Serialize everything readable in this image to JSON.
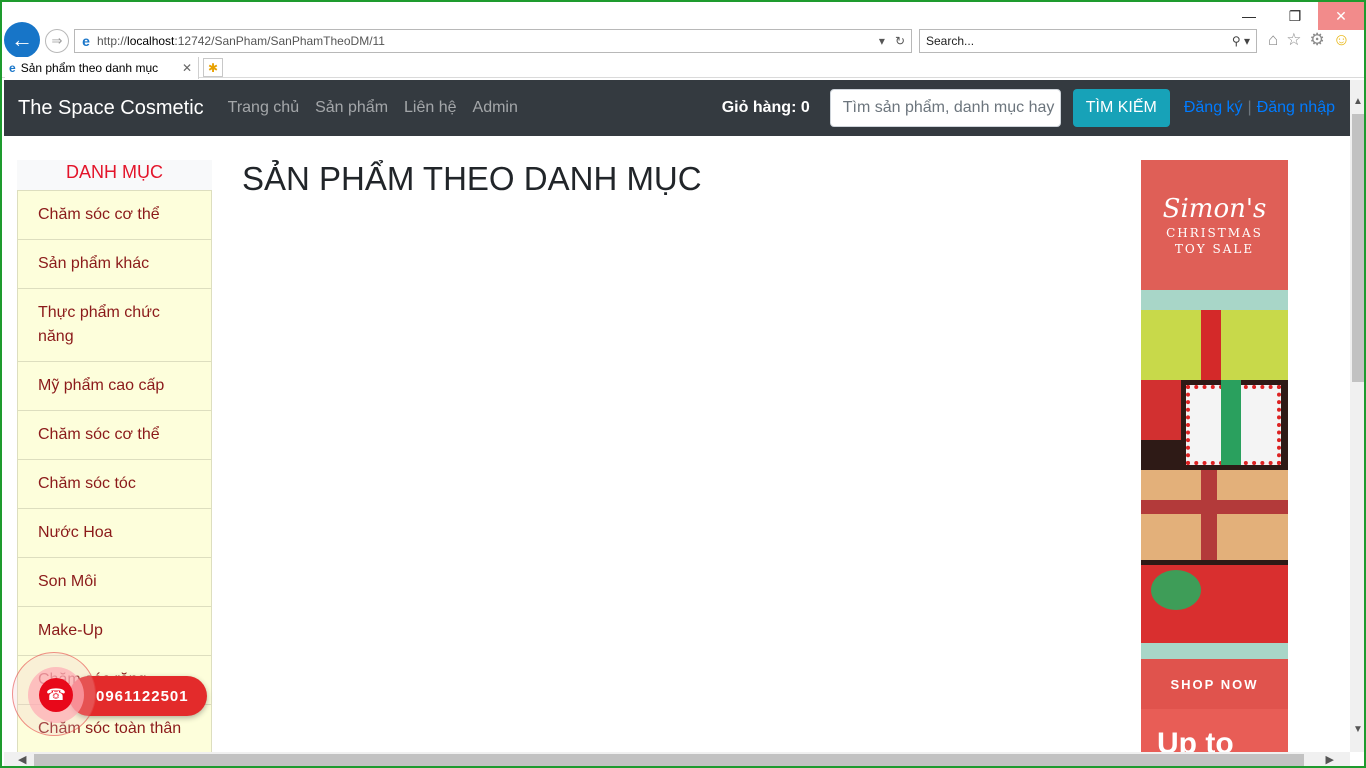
{
  "browser": {
    "url_prefix": "http://",
    "url_host": "localhost",
    "url_path": ":12742/SanPham/SanPhamTheoDM/11",
    "search_placeholder": "Search...",
    "tab_title": "Sản phẩm theo danh mục"
  },
  "navbar": {
    "brand": "The Space Cosmetic",
    "links": [
      "Trang chủ",
      "Sản phẩm",
      "Liên hệ",
      "Admin"
    ],
    "cart_label": "Giỏ hàng: 0",
    "search_placeholder": "Tìm sản phẩm, danh mục hay",
    "search_button": "TÌM KIẾM",
    "register": "Đăng ký",
    "separator": "|",
    "login": "Đăng nhập"
  },
  "sidebar": {
    "heading": "DANH MỤC",
    "categories": [
      "Chăm sóc cơ thể",
      "Sản phẩm khác",
      "Thực phẩm chức năng",
      "Mỹ phẩm cao cấp",
      "Chăm sóc cơ thể",
      "Chăm sóc tóc",
      "Nước Hoa",
      "Son Môi",
      "Make-Up",
      "Chăm sóc răng",
      "Chăm sóc toàn thân"
    ]
  },
  "main": {
    "title": "SẢN PHẨM THEO DANH MỤC"
  },
  "ad": {
    "brand": "Simon's",
    "line1": "CHRISTMAS",
    "line2": "TOY SALE",
    "shop": "SHOP NOW",
    "upto": "Up to"
  },
  "call": {
    "phone": "0961122501"
  },
  "colors": {
    "navbar_bg": "#343a40",
    "search_btn": "#17a2b8",
    "link_blue": "#007bff",
    "category_bg": "#fdfedb",
    "category_text": "#8b1a1a",
    "heading_red": "#e3142a",
    "call_red": "#e32b2b"
  }
}
